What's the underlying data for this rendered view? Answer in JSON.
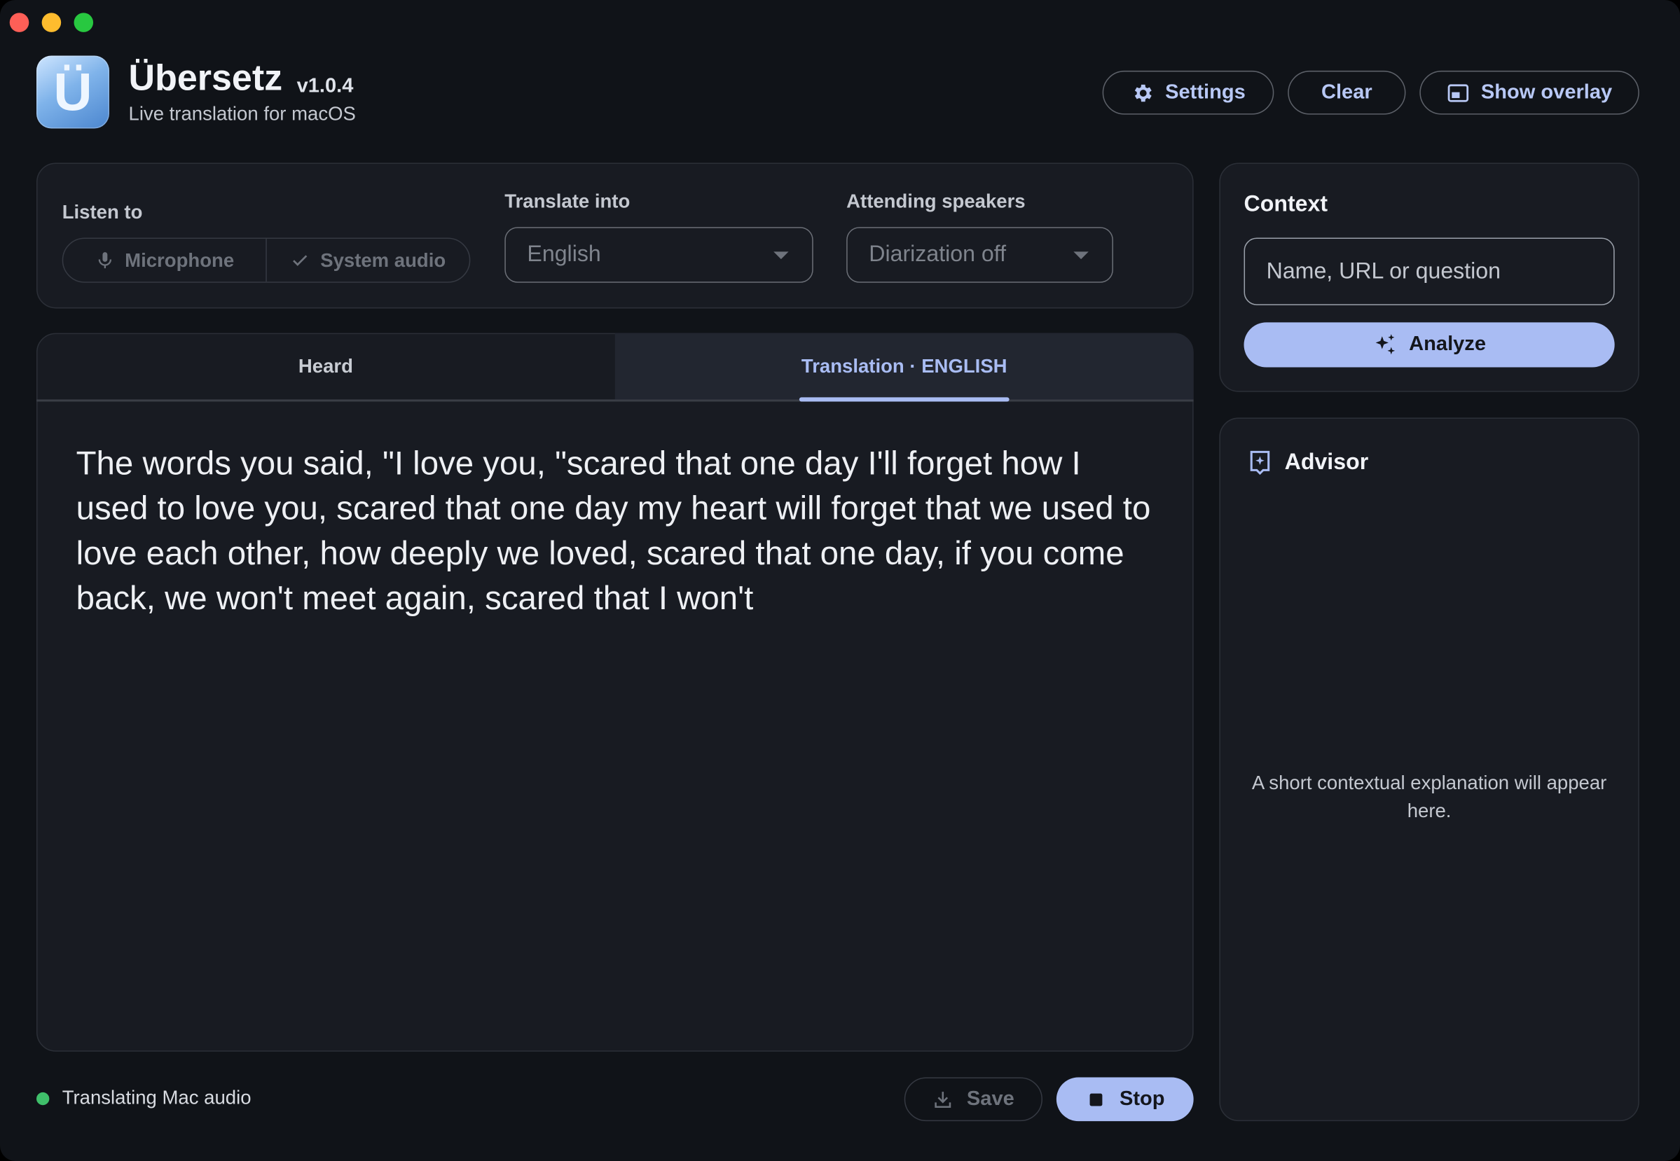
{
  "header": {
    "logo_glyph": "Ü",
    "title": "Übersetz",
    "version": "v1.0.4",
    "subtitle": "Live translation for macOS",
    "buttons": {
      "settings": "Settings",
      "clear": "Clear",
      "overlay": "Show overlay"
    }
  },
  "controls": {
    "listen_label": "Listen to",
    "listen_options": [
      "Microphone",
      "System audio"
    ],
    "listen_selected": "System audio",
    "translate_label": "Translate into",
    "translate_value": "English",
    "speakers_label": "Attending speakers",
    "speakers_value": "Diarization off"
  },
  "tabs": {
    "heard": "Heard",
    "translation": "Translation · ENGLISH",
    "active": "translation"
  },
  "transcript": {
    "text": "The words you said, \"I love you, \"scared that one day I'll forget how I used to love you, scared that one day my heart will forget that we used to love each other, how deeply we loved, scared that one day, if you come back, we won't meet again, scared that I won't"
  },
  "footer": {
    "status": "Translating Mac audio",
    "status_color": "#3fbf6a",
    "save": "Save",
    "stop": "Stop"
  },
  "context": {
    "title": "Context",
    "placeholder": "Name, URL or question",
    "analyze": "Analyze"
  },
  "advisor": {
    "title": "Advisor",
    "hint": "A short contextual explanation will appear here."
  },
  "colors": {
    "accent": "#a9bcf3",
    "background": "#101318",
    "panel": "#181b22"
  }
}
